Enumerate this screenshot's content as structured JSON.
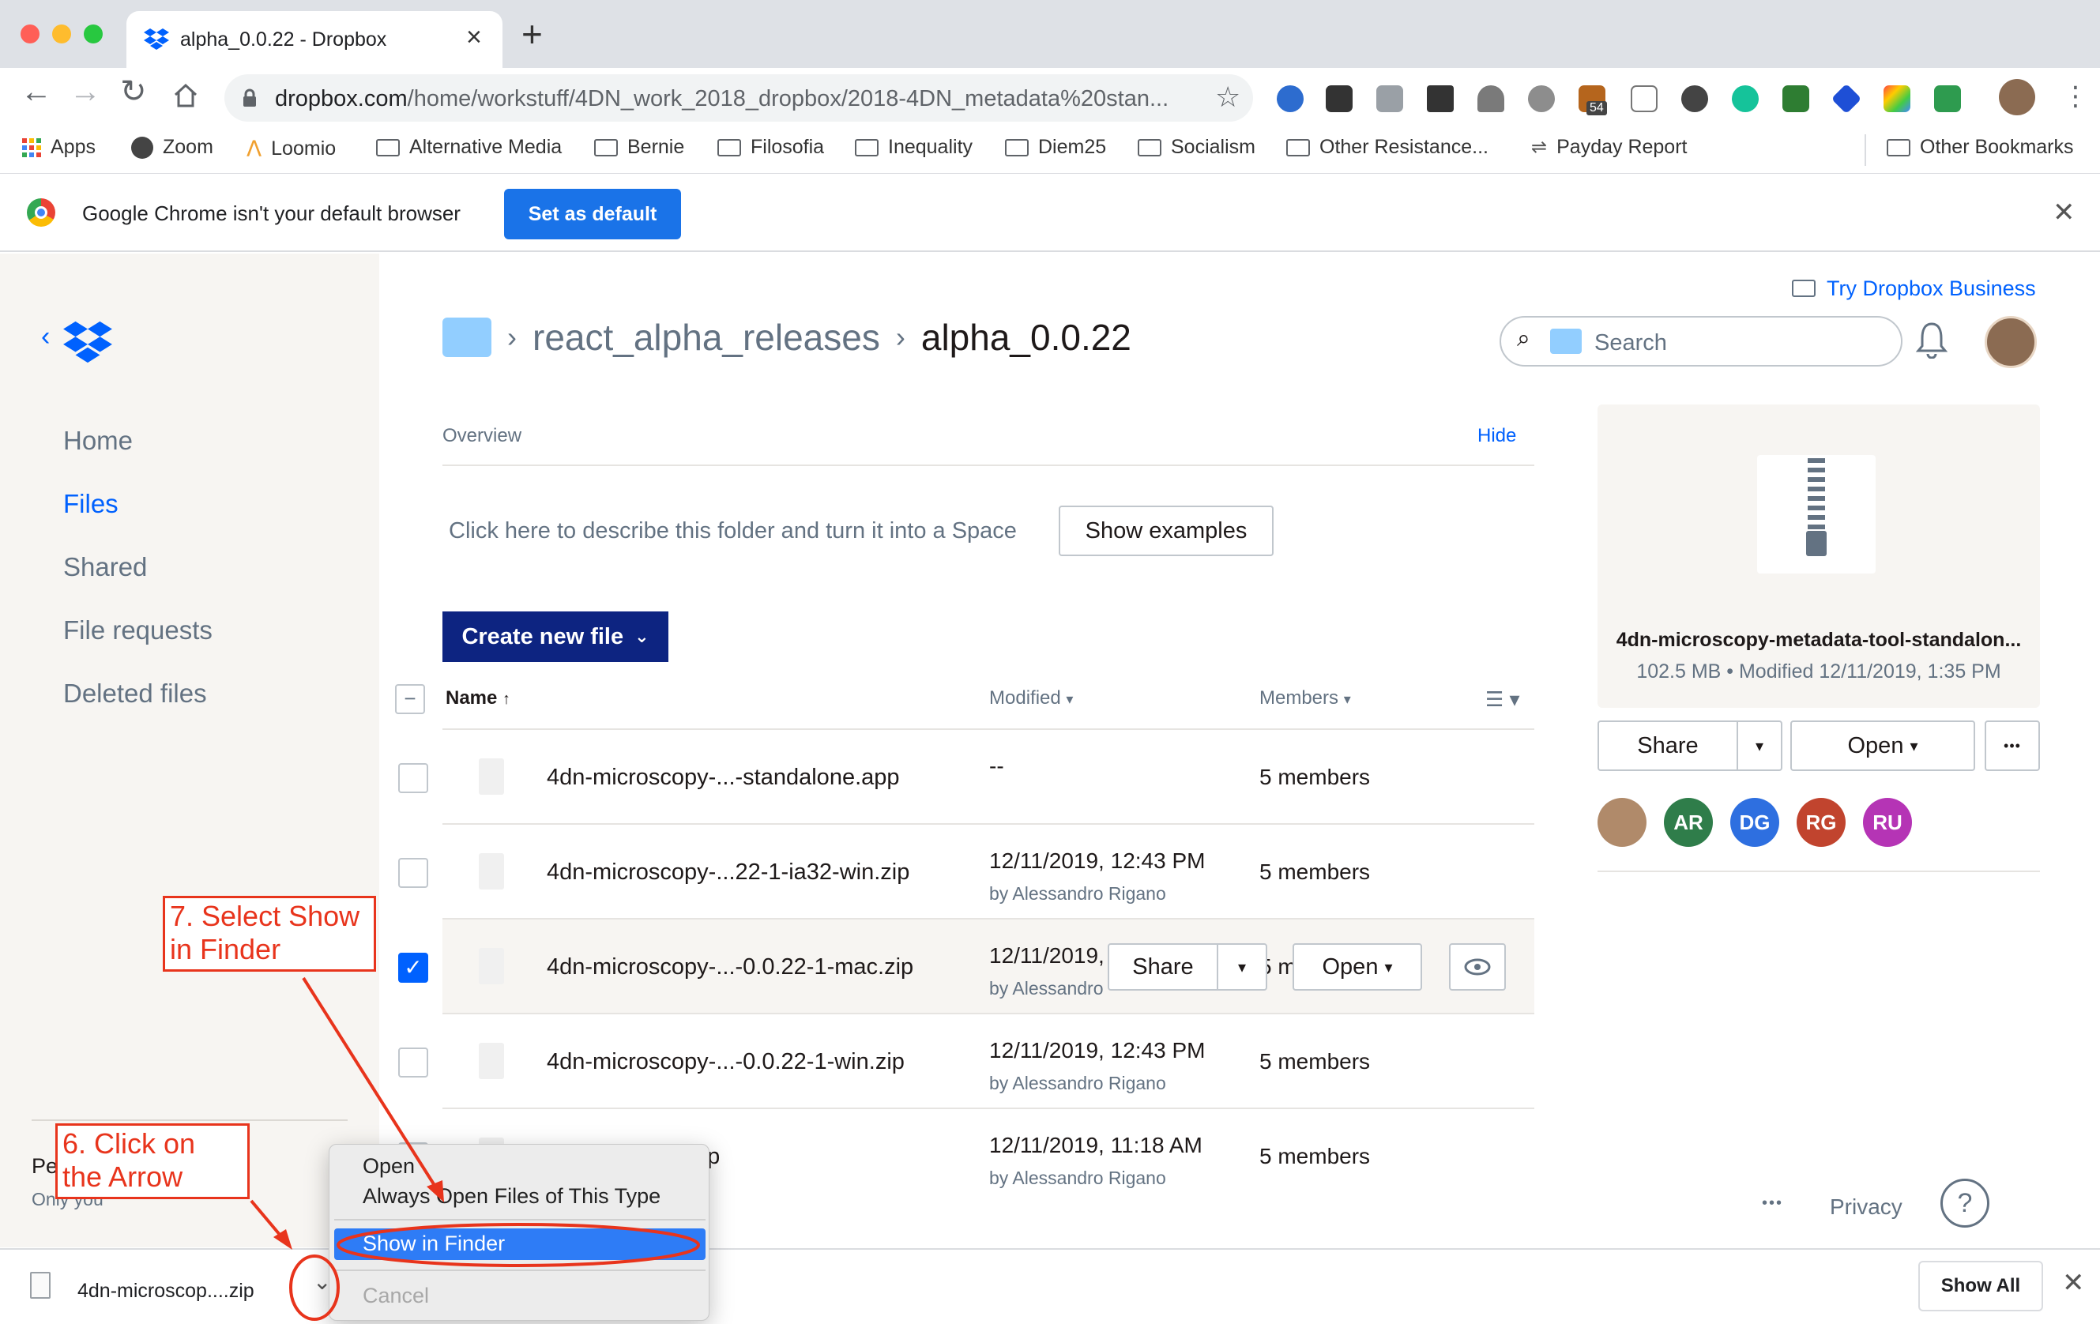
{
  "browser": {
    "tab_title": "alpha_0.0.22 - Dropbox",
    "url_host": "dropbox.com",
    "url_path": "/home/workstuff/4DN_work_2018_dropbox/2018-4DN_metadata%20stan...",
    "extension_badge": "54",
    "bookmarks": [
      "Apps",
      "Zoom",
      "Loomio",
      "Alternative Media",
      "Bernie",
      "Filosofia",
      "Inequality",
      "Diem25",
      "Socialism",
      "Other Resistance...",
      "Payday Report"
    ],
    "other_bookmarks": "Other Bookmarks",
    "infobar_text": "Google Chrome isn't your default browser",
    "set_default_label": "Set as default"
  },
  "sidebar": {
    "items": [
      "Home",
      "Files",
      "Shared",
      "File requests",
      "Deleted files"
    ],
    "active": "Files",
    "footer_title": "Pe",
    "footer_sub": "Only you"
  },
  "header": {
    "try_business": "Try Dropbox Business",
    "crumb_parent": "react_alpha_releases",
    "crumb_current": "alpha_0.0.22",
    "search_placeholder": "Search"
  },
  "overview": {
    "label": "Overview",
    "hide": "Hide",
    "describe": "Click here to describe this folder and turn it into a Space",
    "show_examples": "Show examples"
  },
  "create_new_file": "Create new file",
  "columns": {
    "name": "Name",
    "modified": "Modified",
    "members": "Members"
  },
  "files": [
    {
      "name": "4dn-microscopy-...-standalone.app",
      "modified": "--",
      "by": "",
      "members": "5 members",
      "checked": false
    },
    {
      "name": "4dn-microscopy-...22-1-ia32-win.zip",
      "modified": "12/11/2019, 12:43 PM",
      "by": "by Alessandro Rigano",
      "members": "5 members",
      "checked": false
    },
    {
      "name": "4dn-microscopy-...-0.0.22-1-mac.zip",
      "modified": "12/11/2019,",
      "by": "by Alessandro",
      "members": "5 m",
      "checked": true
    },
    {
      "name": "4dn-microscopy-...-0.0.22-1-win.zip",
      "modified": "12/11/2019, 12:43 PM",
      "by": "by Alessandro Rigano",
      "members": "5 members",
      "checked": false
    },
    {
      "name": "...etadataTool.zip",
      "modified": "12/11/2019, 11:18 AM",
      "by": "by Alessandro Rigano",
      "members": "5 members",
      "checked": false
    }
  ],
  "row_actions": {
    "share": "Share",
    "open": "Open"
  },
  "preview": {
    "name": "4dn-microscopy-metadata-tool-standalon...",
    "meta": "102.5 MB • Modified 12/11/2019, 1:35 PM",
    "share": "Share",
    "open": "Open",
    "more": "•••",
    "members": [
      {
        "initials": "",
        "color": "#b08a6a"
      },
      {
        "initials": "AR",
        "color": "#2f7d4a"
      },
      {
        "initials": "DG",
        "color": "#2e6fe0"
      },
      {
        "initials": "RG",
        "color": "#c1442e"
      },
      {
        "initials": "RU",
        "color": "#b534b5"
      }
    ]
  },
  "footer": {
    "more": "•••",
    "privacy": "Privacy",
    "help": "?"
  },
  "download": {
    "file": "4dn-microscop....zip",
    "show_all": "Show All"
  },
  "context_menu": {
    "open": "Open",
    "always_open": "Always Open Files of This Type",
    "show_in_finder": "Show in Finder",
    "cancel": "Cancel"
  },
  "annotations": {
    "step7": "7. Select Show in Finder",
    "step6": "6. Click on the Arrow"
  },
  "colors": {
    "accent": "#0061fe",
    "navy": "#0d2481",
    "annotation": "#e8341c"
  }
}
